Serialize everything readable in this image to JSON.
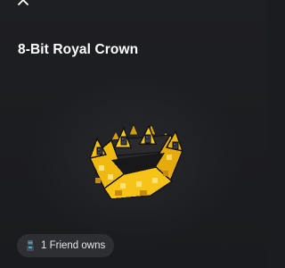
{
  "item": {
    "title": "8-Bit Royal Crown"
  },
  "friends": {
    "label": "1 Friend owns"
  },
  "icons": {
    "close": "close-icon",
    "friend_avatar": "friend-avatar-icon",
    "item_image": "crown-image"
  },
  "colors": {
    "background": "#1b1c1f",
    "chip": "#2d2f33",
    "crown_gold": "#f0b90f",
    "text": "#ffffff"
  }
}
